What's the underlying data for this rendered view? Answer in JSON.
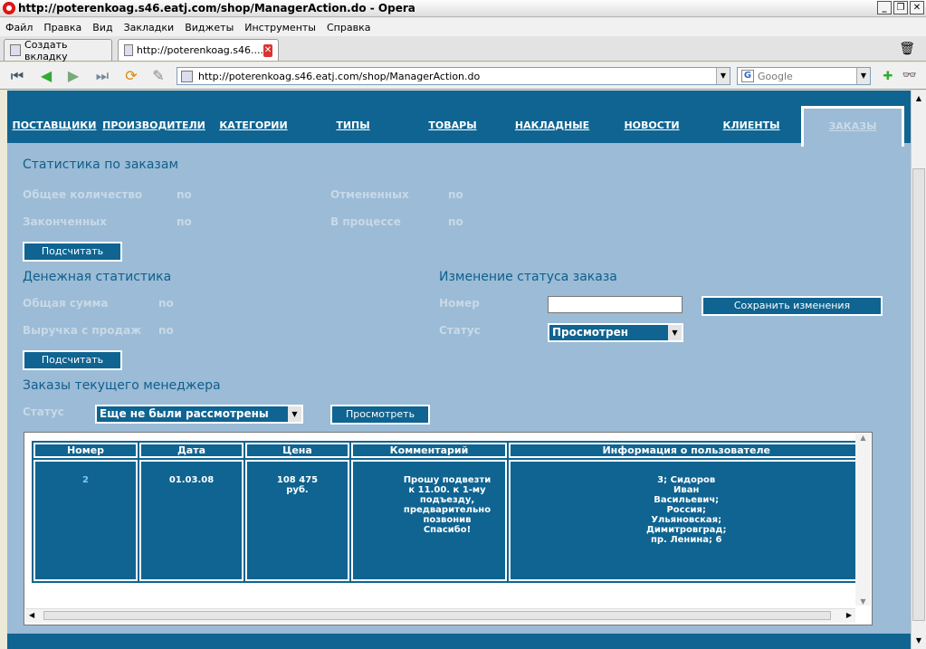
{
  "window": {
    "title": "http://poterenkoag.s46.eatj.com/shop/ManagerAction.do - Opera"
  },
  "menu": [
    "Файл",
    "Правка",
    "Вид",
    "Закладки",
    "Виджеты",
    "Инструменты",
    "Справка"
  ],
  "tabs": {
    "new_tab": "Создать вкладку",
    "current": "http://poterenkoag.s46...."
  },
  "address": {
    "url": "http://poterenkoag.s46.eatj.com/shop/ManagerAction.do",
    "search_placeholder": "Google"
  },
  "nav": [
    "ПОСТАВЩИКИ",
    "ПРОИЗВОДИТЕЛИ",
    "КАТЕГОРИИ",
    "ТИПЫ",
    "ТОВАРЫ",
    "НАКЛАДНЫЕ",
    "НОВОСТИ",
    "КЛИЕНТЫ"
  ],
  "nav_active": "ЗАКАЗЫ",
  "stats": {
    "title": "Статистика по заказам",
    "total_label": "Общее количество",
    "total_value": "no",
    "cancelled_label": "Отмененных",
    "cancelled_value": "no",
    "finished_label": "Законченных",
    "finished_value": "no",
    "inprogress_label": "В процессе",
    "inprogress_value": "no",
    "calc_button": "Подсчитать"
  },
  "money": {
    "title": "Денежная статистика",
    "sum_label": "Общая сумма",
    "sum_value": "no",
    "revenue_label": "Выручка с продаж",
    "revenue_value": "no",
    "calc_button": "Подсчитать"
  },
  "status_change": {
    "title": "Изменение статуса заказа",
    "number_label": "Номер",
    "number_value": "",
    "status_label": "Статус",
    "status_value": "Просмотрен",
    "save_button": "Сохранить изменения"
  },
  "manager_orders": {
    "title": "Заказы текущего менеджера",
    "status_label": "Статус",
    "status_value": "Еще не были рассмотрены",
    "view_button": "Просмотреть"
  },
  "table": {
    "headers": [
      "Номер",
      "Дата",
      "Цена",
      "Комментарий",
      "Информация о пользователе"
    ],
    "rows": [
      {
        "number": "2",
        "date": "01.03.08",
        "price": "108 475 руб.",
        "comment": "Прошу подвезти к 11.00. к 1-му подъезду, предварительно позвонив Спасибо!",
        "user": "3; Сидоров Иван Васильевич; Россия; Ульяновская; Димитровград; пр. Ленина; 6"
      }
    ]
  }
}
